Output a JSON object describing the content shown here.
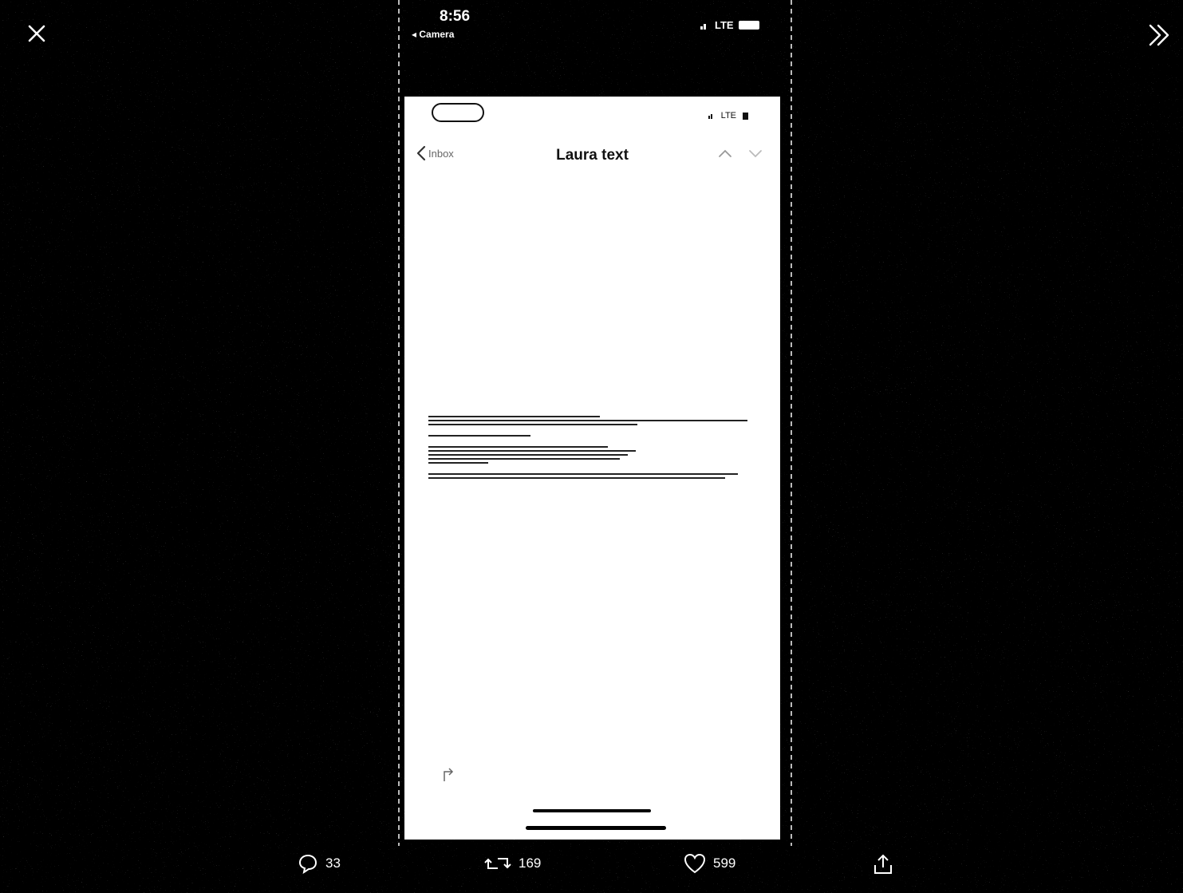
{
  "viewer": {
    "close_icon": "close-icon",
    "next_icon": "double-chevron-right-icon"
  },
  "outer_status": {
    "time": "8:56",
    "back_label": "◂ Camera",
    "signal": "LTE"
  },
  "inner_screen": {
    "pill_label": "",
    "signal": "LTE",
    "back_label": "Inbox",
    "title": "Laura text"
  },
  "actions": {
    "reply_count": "33",
    "retweet_count": "169",
    "like_count": "599"
  },
  "colors": {
    "background": "#000000",
    "screen": "#ffffff",
    "text_light": "#ffffff"
  }
}
